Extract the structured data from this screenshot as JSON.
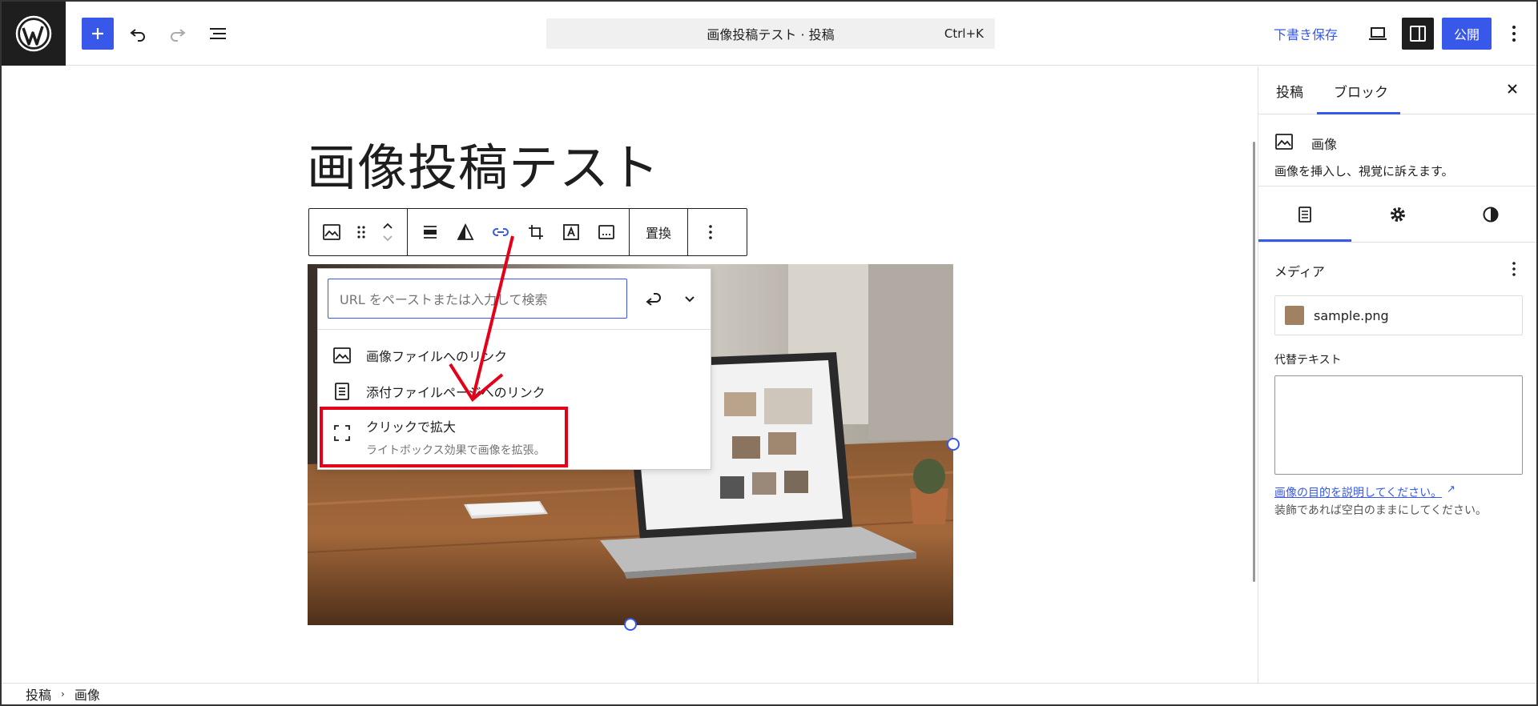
{
  "header": {
    "doc_title": "画像投稿テスト · 投稿",
    "shortcut": "Ctrl+K",
    "save_draft": "下書き保存",
    "publish": "公開"
  },
  "editor": {
    "post_title": "画像投稿テスト",
    "toolbar": {
      "replace": "置換"
    },
    "link_popover": {
      "url_placeholder": "URL をペーストまたは入力して検索",
      "items": [
        {
          "label": "画像ファイルへのリンク",
          "icon": "image-icon"
        },
        {
          "label": "添付ファイルページへのリンク",
          "icon": "page-icon"
        },
        {
          "label": "クリックで拡大",
          "desc": "ライトボックス効果で画像を拡張。",
          "icon": "fullscreen-icon"
        }
      ]
    }
  },
  "sidebar": {
    "tabs": [
      "投稿",
      "ブロック"
    ],
    "active_tab": "ブロック",
    "block_name": "画像",
    "block_desc": "画像を挿入し、視覚に訴えます。",
    "media_label": "メディア",
    "media_file": "sample.png",
    "alt_label": "代替テキスト",
    "alt_help_link": "画像の目的を説明してください。",
    "alt_help_text": "装飾であれば空白のままにしてください。"
  },
  "breadcrumb": [
    "投稿",
    "画像"
  ],
  "colors": {
    "accent": "#3858e9",
    "annotation_red": "#e5001a",
    "dark": "#1e1e1e"
  }
}
